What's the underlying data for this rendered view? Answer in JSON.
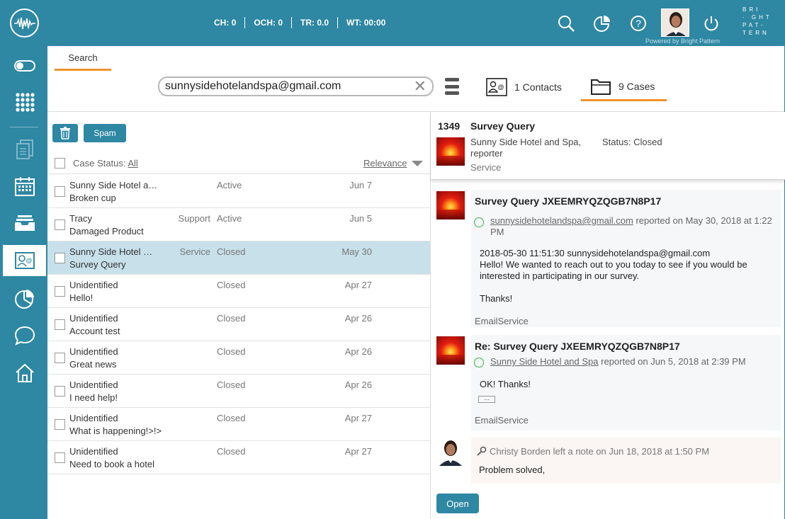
{
  "header": {
    "counters": [
      {
        "label": "CH: 0"
      },
      {
        "label": "OCH: 0"
      },
      {
        "label": "TR: 0.0"
      },
      {
        "label": "WT: 00:00"
      }
    ],
    "brand_lines": [
      "BRI",
      "· GHT",
      "PAT-",
      "TERN"
    ],
    "powered_by": "Powered by Bright Pattern"
  },
  "search": {
    "tab_label": "Search",
    "query": "sunnysidehotelandspa@gmail.com",
    "contacts_tab": "1 Contacts",
    "cases_tab": "9 Cases"
  },
  "list": {
    "spam_label": "Spam",
    "filter_label": "Case Status:",
    "filter_value": "All",
    "sort_label": "Relevance",
    "rows": [
      {
        "from": "Sunny Side Hotel and Spa",
        "subject": "Broken cup",
        "service": "",
        "status": "Active",
        "date": "Jun 7"
      },
      {
        "from": "Tracy",
        "subject": "Damaged Product",
        "service": "Support",
        "status": "Active",
        "date": "Jun 5"
      },
      {
        "from": "Sunny Side Hotel and Spa",
        "subject": "Survey Query",
        "service": "Service",
        "status": "Closed",
        "date": "May 30"
      },
      {
        "from": "Unidentified",
        "subject": "Hello!",
        "service": "",
        "status": "Closed",
        "date": "Apr 27"
      },
      {
        "from": "Unidentified",
        "subject": "Account test",
        "service": "",
        "status": "Closed",
        "date": "Apr 26"
      },
      {
        "from": "Unidentified",
        "subject": "Great news",
        "service": "",
        "status": "Closed",
        "date": "Apr 26"
      },
      {
        "from": "Unidentified",
        "subject": "I need help!",
        "service": "",
        "status": "Closed",
        "date": "Apr 26"
      },
      {
        "from": "Unidentified",
        "subject": "What is happening!>!>",
        "service": "",
        "status": "Closed",
        "date": "Apr 27"
      },
      {
        "from": "Unidentified",
        "subject": "Need to book a hotel",
        "service": "",
        "status": "Closed",
        "date": "Apr 27"
      }
    ]
  },
  "detail": {
    "case_number": "1349",
    "case_title": "Survey Query",
    "customer": "Sunny Side Hotel and Spa, reporter",
    "status": "Status: Closed",
    "service": "Service",
    "messages": [
      {
        "title": "Survey Query JXEEMRYQZQGB7N8P17",
        "sender": "sunnysidehotelandspa@gmail.com",
        "reported": "reported on May 30, 2018 at 1:22 PM",
        "body_line1": "2018-05-30 11:51:30 sunnysidehotelandspa@gmail.com",
        "body_line2": "Hello! We wanted to reach out to you today to see if you would be interested in participating in our survey.",
        "body_line3": "Thanks!",
        "footer": "EmailService"
      },
      {
        "title": "Re: Survey Query JXEEMRYQZQGB7N8P17",
        "sender": "Sunny Side Hotel and Spa",
        "reported": "reported on Jun 5, 2018 at 2:39 PM",
        "body_line1": "OK! Thanks!",
        "footer": "EmailService"
      }
    ],
    "note": {
      "meta": "Christy Borden left a note on Jun 18, 2018 at 1:50 PM",
      "body": "Problem solved,"
    },
    "open_label": "Open"
  },
  "colors": {
    "primary": "#2e87a3",
    "accent": "#f0922c",
    "selected_row": "#c7e0ea"
  }
}
